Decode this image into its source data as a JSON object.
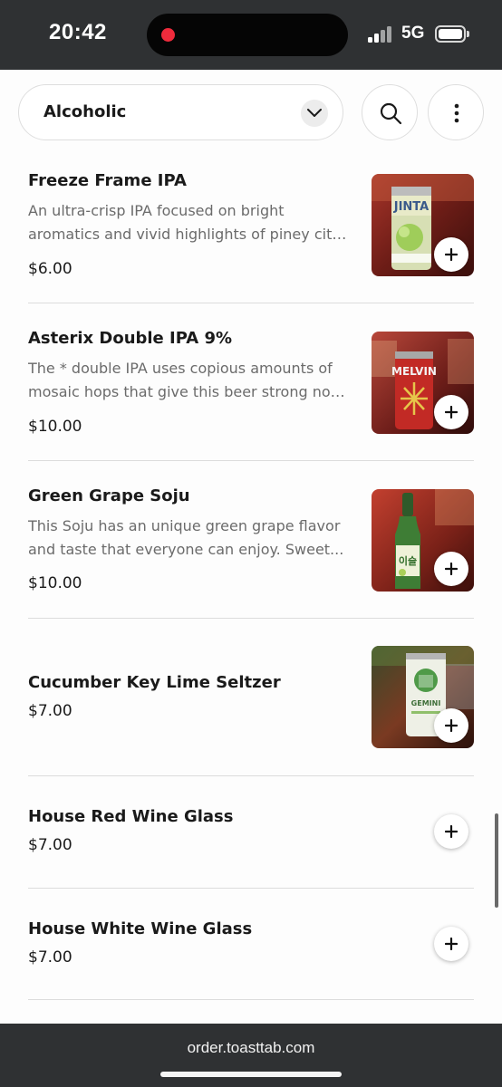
{
  "status_bar": {
    "time": "20:42",
    "network": "5G"
  },
  "toolbar": {
    "category": "Alcoholic",
    "icons": [
      "chevron-down-icon",
      "search-icon",
      "more-vertical-icon"
    ]
  },
  "menu_items": [
    {
      "name": "Freeze Frame IPA",
      "description_lines": [
        "An ultra-crisp IPA focused on bright",
        "aromatics and vivid highlights of piney citr..."
      ],
      "price": "$6.00",
      "has_image": true,
      "image_label": "JINTA"
    },
    {
      "name": "Asterix Double IPA 9%",
      "description_lines": [
        "The * double IPA uses copious amounts of",
        "mosaic hops that give this beer strong not..."
      ],
      "price": "$10.00",
      "has_image": true,
      "image_label": "MELVIN"
    },
    {
      "name": "Green Grape Soju",
      "description_lines": [
        "This Soju has an unique green grape flavor",
        "and taste that everyone can enjoy. Sweet..."
      ],
      "price": "$10.00",
      "has_image": true,
      "image_label": "이슬"
    },
    {
      "name": "Cucumber Key Lime Seltzer",
      "description_lines": [],
      "price": "$7.00",
      "has_image": true,
      "image_label": "GEMINI"
    },
    {
      "name": "House Red Wine Glass",
      "description_lines": [],
      "price": "$7.00",
      "has_image": false
    },
    {
      "name": "House White Wine Glass",
      "description_lines": [],
      "price": "$7.00",
      "has_image": false
    }
  ],
  "browser": {
    "url": "order.toasttab.com"
  },
  "colors": {
    "system_bar": "#2f3133",
    "background": "#fdfdfd",
    "divider": "#dcdcdc",
    "recording_dot": "#ef2b3c"
  }
}
